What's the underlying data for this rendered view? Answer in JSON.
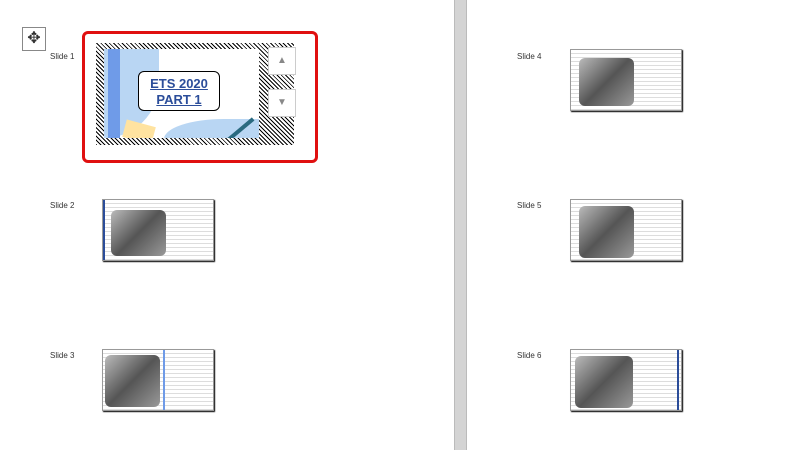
{
  "slide_labels": [
    "Slide 1",
    "Slide 2",
    "Slide 3",
    "Slide 4",
    "Slide 5",
    "Slide 6"
  ],
  "slide1": {
    "title_line1": "ETS 2020",
    "title_line2": "PART 1"
  },
  "icons": {
    "move": "move-handle-icon",
    "up": "scroll-up-icon",
    "down": "scroll-down-icon"
  },
  "colors": {
    "selection": "#e01010",
    "title": "#2b4d9a"
  }
}
